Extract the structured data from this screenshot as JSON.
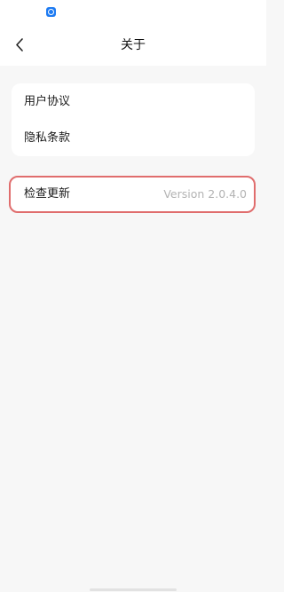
{
  "status_bar": {
    "app_icon": "app-notification-icon",
    "app_icon_color": "#1e7bf2"
  },
  "nav": {
    "back_icon": "chevron-left-icon",
    "title": "关于"
  },
  "settings": {
    "items": [
      {
        "label": "用户协议"
      },
      {
        "label": "隐私条款"
      }
    ]
  },
  "update": {
    "label": "检查更新",
    "version": "Version 2.0.4.0",
    "highlight_color": "#e06d6d"
  }
}
